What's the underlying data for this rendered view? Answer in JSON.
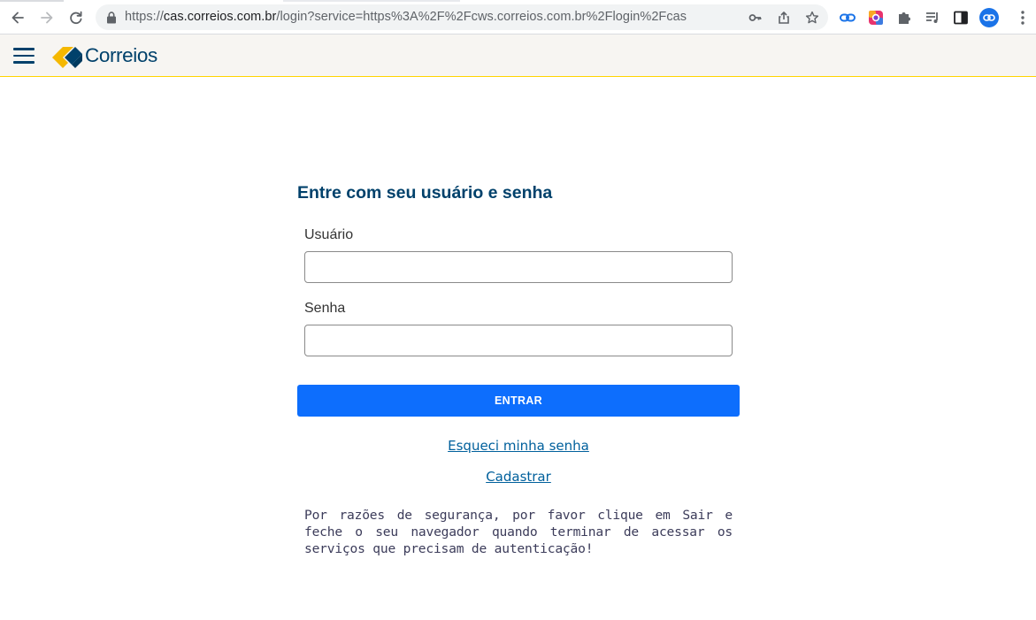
{
  "browser": {
    "url_scheme": "https://",
    "url_host": "cas.correios.com.br",
    "url_path": "/login?service=https%3A%2F%2Fcws.correios.com.br%2Flogin%2Fcas",
    "icons": [
      "back-icon",
      "forward-icon",
      "reload-icon",
      "lock-icon",
      "key-icon",
      "share-icon",
      "star-icon",
      "link-extension-icon",
      "color-extension-icon",
      "puzzle-icon",
      "media-icon",
      "sidepanel-icon",
      "profile-icon",
      "menu-icon"
    ]
  },
  "header": {
    "logo_text": "Correios",
    "brand_color": "#00416b",
    "accent_color": "#ffd400"
  },
  "login": {
    "title": "Entre com seu usuário e senha",
    "username_label": "Usuário",
    "username_value": "",
    "password_label": "Senha",
    "password_value": "",
    "submit_label": "ENTRAR",
    "forgot_link": "Esqueci minha senha",
    "register_link": "Cadastrar",
    "security_notice": "Por razões de segurança, por favor clique em Sair e feche o seu navegador quando terminar de acessar os serviços que precisam de autenticação!",
    "button_color": "#0d6efd"
  }
}
